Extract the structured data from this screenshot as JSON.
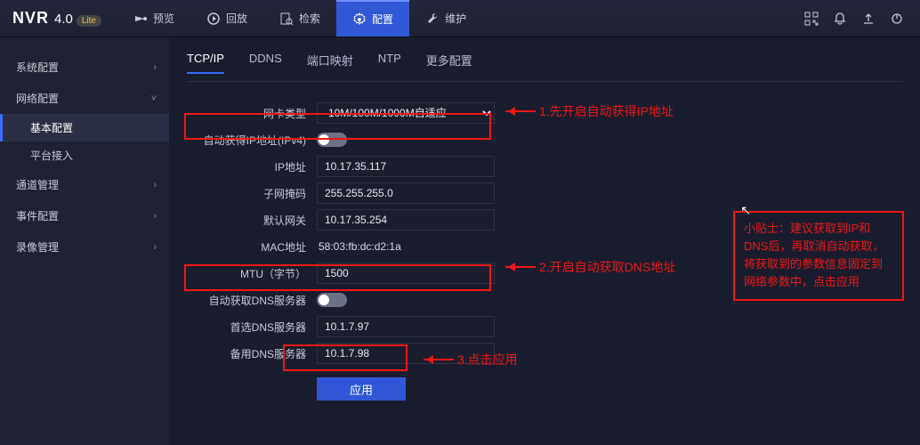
{
  "brand": {
    "name": "NVR",
    "version": "4.0",
    "edition": "Lite"
  },
  "topnav": {
    "preview": "预览",
    "playback": "回放",
    "search": "检索",
    "config": "配置",
    "maintain": "维护"
  },
  "sidebar": {
    "sysconfig": "系统配置",
    "netconfig": "网络配置",
    "basic": "基本配置",
    "platform": "平台接入",
    "channel": "通道管理",
    "event": "事件配置",
    "record": "录像管理"
  },
  "subtabs": {
    "tcpip": "TCP/IP",
    "ddns": "DDNS",
    "portmap": "端口映射",
    "ntp": "NTP",
    "more": "更多配置"
  },
  "form": {
    "nictype_label": "网卡类型",
    "nictype_value": "10M/100M/1000M自适应",
    "autoip_label": "自动获得IP地址(IPv4)",
    "ip_label": "IP地址",
    "ip_value": "10.17.35.117",
    "mask_label": "子网掩码",
    "mask_value": "255.255.255.0",
    "gw_label": "默认网关",
    "gw_value": "10.17.35.254",
    "mac_label": "MAC地址",
    "mac_value": "58:03:fb:dc:d2:1a",
    "mtu_label": "MTU（字节）",
    "mtu_value": "1500",
    "autodns_label": "自动获取DNS服务器",
    "dns1_label": "首选DNS服务器",
    "dns1_value": "10.1.7.97",
    "dns2_label": "备用DNS服务器",
    "dns2_value": "10.1.7.98",
    "apply": "应用"
  },
  "annotations": {
    "step1": "1.先开启自动获得IP地址",
    "step2": "2.开启自动获取DNS地址",
    "step3": "3.点击应用",
    "tip": "小贴士：建议获取到IP和DNS后，再取消自动获取，将获取到的参数信息固定到网络参数中，点击应用"
  },
  "colors": {
    "accent": "#3058d6",
    "annotation": "#f01717"
  }
}
